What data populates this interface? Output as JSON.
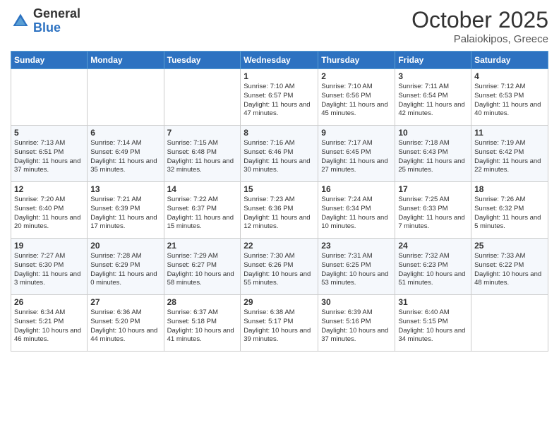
{
  "header": {
    "logo_general": "General",
    "logo_blue": "Blue",
    "month": "October 2025",
    "location": "Palaiokipos, Greece"
  },
  "weekdays": [
    "Sunday",
    "Monday",
    "Tuesday",
    "Wednesday",
    "Thursday",
    "Friday",
    "Saturday"
  ],
  "weeks": [
    [
      {
        "day": "",
        "info": ""
      },
      {
        "day": "",
        "info": ""
      },
      {
        "day": "",
        "info": ""
      },
      {
        "day": "1",
        "info": "Sunrise: 7:10 AM\nSunset: 6:57 PM\nDaylight: 11 hours and 47 minutes."
      },
      {
        "day": "2",
        "info": "Sunrise: 7:10 AM\nSunset: 6:56 PM\nDaylight: 11 hours and 45 minutes."
      },
      {
        "day": "3",
        "info": "Sunrise: 7:11 AM\nSunset: 6:54 PM\nDaylight: 11 hours and 42 minutes."
      },
      {
        "day": "4",
        "info": "Sunrise: 7:12 AM\nSunset: 6:53 PM\nDaylight: 11 hours and 40 minutes."
      }
    ],
    [
      {
        "day": "5",
        "info": "Sunrise: 7:13 AM\nSunset: 6:51 PM\nDaylight: 11 hours and 37 minutes."
      },
      {
        "day": "6",
        "info": "Sunrise: 7:14 AM\nSunset: 6:49 PM\nDaylight: 11 hours and 35 minutes."
      },
      {
        "day": "7",
        "info": "Sunrise: 7:15 AM\nSunset: 6:48 PM\nDaylight: 11 hours and 32 minutes."
      },
      {
        "day": "8",
        "info": "Sunrise: 7:16 AM\nSunset: 6:46 PM\nDaylight: 11 hours and 30 minutes."
      },
      {
        "day": "9",
        "info": "Sunrise: 7:17 AM\nSunset: 6:45 PM\nDaylight: 11 hours and 27 minutes."
      },
      {
        "day": "10",
        "info": "Sunrise: 7:18 AM\nSunset: 6:43 PM\nDaylight: 11 hours and 25 minutes."
      },
      {
        "day": "11",
        "info": "Sunrise: 7:19 AM\nSunset: 6:42 PM\nDaylight: 11 hours and 22 minutes."
      }
    ],
    [
      {
        "day": "12",
        "info": "Sunrise: 7:20 AM\nSunset: 6:40 PM\nDaylight: 11 hours and 20 minutes."
      },
      {
        "day": "13",
        "info": "Sunrise: 7:21 AM\nSunset: 6:39 PM\nDaylight: 11 hours and 17 minutes."
      },
      {
        "day": "14",
        "info": "Sunrise: 7:22 AM\nSunset: 6:37 PM\nDaylight: 11 hours and 15 minutes."
      },
      {
        "day": "15",
        "info": "Sunrise: 7:23 AM\nSunset: 6:36 PM\nDaylight: 11 hours and 12 minutes."
      },
      {
        "day": "16",
        "info": "Sunrise: 7:24 AM\nSunset: 6:34 PM\nDaylight: 11 hours and 10 minutes."
      },
      {
        "day": "17",
        "info": "Sunrise: 7:25 AM\nSunset: 6:33 PM\nDaylight: 11 hours and 7 minutes."
      },
      {
        "day": "18",
        "info": "Sunrise: 7:26 AM\nSunset: 6:32 PM\nDaylight: 11 hours and 5 minutes."
      }
    ],
    [
      {
        "day": "19",
        "info": "Sunrise: 7:27 AM\nSunset: 6:30 PM\nDaylight: 11 hours and 3 minutes."
      },
      {
        "day": "20",
        "info": "Sunrise: 7:28 AM\nSunset: 6:29 PM\nDaylight: 11 hours and 0 minutes."
      },
      {
        "day": "21",
        "info": "Sunrise: 7:29 AM\nSunset: 6:27 PM\nDaylight: 10 hours and 58 minutes."
      },
      {
        "day": "22",
        "info": "Sunrise: 7:30 AM\nSunset: 6:26 PM\nDaylight: 10 hours and 55 minutes."
      },
      {
        "day": "23",
        "info": "Sunrise: 7:31 AM\nSunset: 6:25 PM\nDaylight: 10 hours and 53 minutes."
      },
      {
        "day": "24",
        "info": "Sunrise: 7:32 AM\nSunset: 6:23 PM\nDaylight: 10 hours and 51 minutes."
      },
      {
        "day": "25",
        "info": "Sunrise: 7:33 AM\nSunset: 6:22 PM\nDaylight: 10 hours and 48 minutes."
      }
    ],
    [
      {
        "day": "26",
        "info": "Sunrise: 6:34 AM\nSunset: 5:21 PM\nDaylight: 10 hours and 46 minutes."
      },
      {
        "day": "27",
        "info": "Sunrise: 6:36 AM\nSunset: 5:20 PM\nDaylight: 10 hours and 44 minutes."
      },
      {
        "day": "28",
        "info": "Sunrise: 6:37 AM\nSunset: 5:18 PM\nDaylight: 10 hours and 41 minutes."
      },
      {
        "day": "29",
        "info": "Sunrise: 6:38 AM\nSunset: 5:17 PM\nDaylight: 10 hours and 39 minutes."
      },
      {
        "day": "30",
        "info": "Sunrise: 6:39 AM\nSunset: 5:16 PM\nDaylight: 10 hours and 37 minutes."
      },
      {
        "day": "31",
        "info": "Sunrise: 6:40 AM\nSunset: 5:15 PM\nDaylight: 10 hours and 34 minutes."
      },
      {
        "day": "",
        "info": ""
      }
    ]
  ]
}
